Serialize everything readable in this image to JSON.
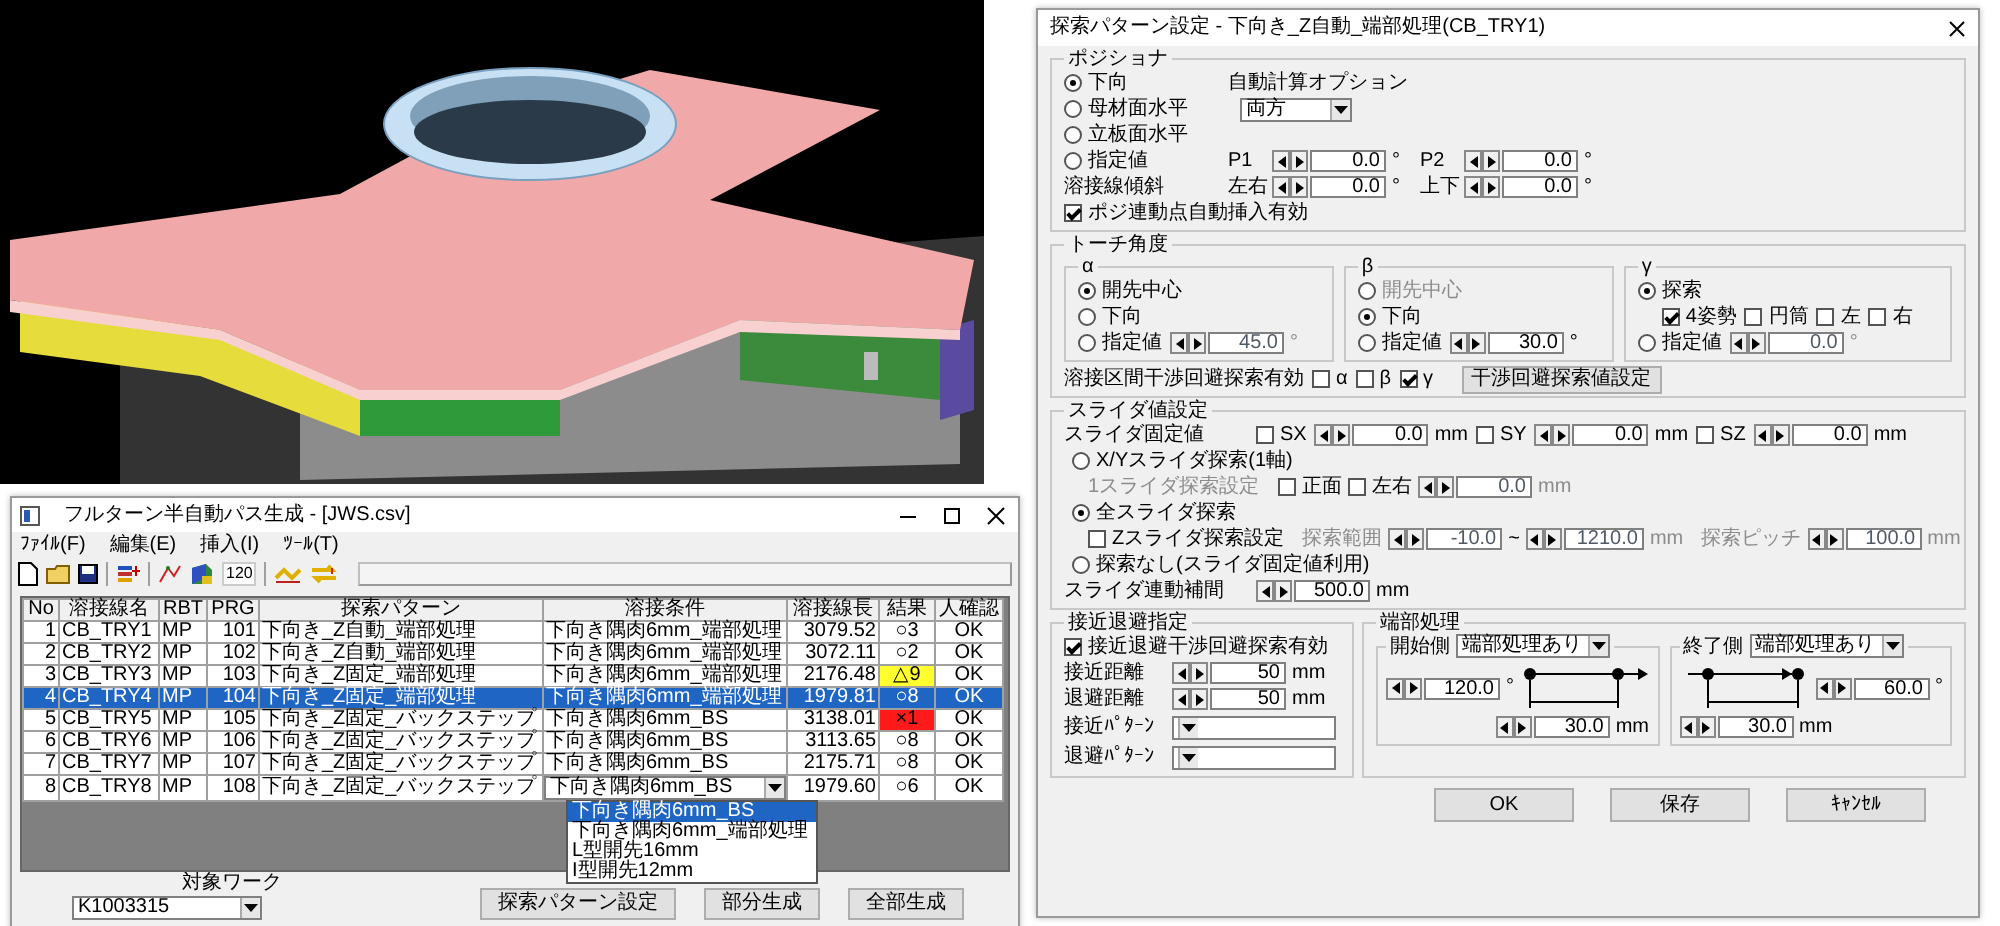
{
  "main_window": {
    "title": "フルターン半自動パス生成 - [JWS.csv]",
    "menu": [
      "ﾌｧｲﾙ(F)",
      "編集(E)",
      "挿入(I)",
      "ﾂｰﾙ(T)"
    ],
    "toolbar_text": "120",
    "table": {
      "columns": [
        "No",
        "溶接線名",
        "RBT",
        "PRG",
        "探索パターン",
        "溶接条件",
        "溶接線長",
        "結果",
        "人確認"
      ],
      "rows": [
        {
          "cells": [
            "1",
            "CB_TRY1",
            "MP",
            "101",
            "下向き_Z自動_端部処理",
            "下向き隅肉6mm_端部処理",
            "3079.52",
            "○3",
            "OK"
          ],
          "selected": false,
          "editing": false
        },
        {
          "cells": [
            "2",
            "CB_TRY2",
            "MP",
            "102",
            "下向き_Z自動_端部処理",
            "下向き隅肉6mm_端部処理",
            "3072.11",
            "○2",
            "OK"
          ],
          "selected": false,
          "editing": false
        },
        {
          "cells": [
            "3",
            "CB_TRY3",
            "MP",
            "103",
            "下向き_Z固定_端部処理",
            "下向き隅肉6mm_端部処理",
            "2176.48",
            "△9",
            "OK"
          ],
          "selected": false,
          "color": "#ffff30",
          "editing": false
        },
        {
          "cells": [
            "4",
            "CB_TRY4",
            "MP",
            "104",
            "下向き_Z固定_端部処理",
            "下向き隅肉6mm_端部処理",
            "1979.81",
            "○8",
            "OK"
          ],
          "selected": true,
          "editing": false
        },
        {
          "cells": [
            "5",
            "CB_TRY5",
            "MP",
            "105",
            "下向き_Z固定_バックステップ",
            "下向き隅肉6mm_BS",
            "3138.01",
            "×1",
            "OK"
          ],
          "selected": false,
          "color": "#ff1a1a",
          "editing": false
        },
        {
          "cells": [
            "6",
            "CB_TRY6",
            "MP",
            "106",
            "下向き_Z固定_バックステップ",
            "下向き隅肉6mm_BS",
            "3113.65",
            "○8",
            "OK"
          ],
          "selected": false,
          "editing": false
        },
        {
          "cells": [
            "7",
            "CB_TRY7",
            "MP",
            "107",
            "下向き_Z固定_バックステップ",
            "下向き隅肉6mm_BS",
            "2175.71",
            "○8",
            "OK"
          ],
          "selected": false,
          "editing": false
        },
        {
          "cells": [
            "8",
            "CB_TRY8",
            "MP",
            "108",
            "下向き_Z固定_バックステップ",
            "下向き隅肉6mm_BS",
            "1979.60",
            "○6",
            "OK"
          ],
          "selected": false,
          "editing": true
        }
      ]
    },
    "dropdown_options": [
      {
        "label": "下向き隅肉6mm_BS",
        "selected": true
      },
      {
        "label": "下向き隅肉6mm_端部処理",
        "selected": false
      },
      {
        "label": "L型開先16mm",
        "selected": false
      },
      {
        "label": "I型開先12mm",
        "selected": false
      }
    ],
    "target": {
      "label": "対象ワーク",
      "value": "K1003315"
    },
    "buttons": [
      "探索パターン設定",
      "部分生成",
      "全部生成"
    ]
  },
  "dialog": {
    "title": "探索パターン設定 - 下向き_Z自動_端部処理(CB_TRY1)",
    "positioner": {
      "label": "ポジショナ",
      "radios": [
        {
          "label": "下向",
          "selected": true
        },
        {
          "label": "母材面水平",
          "selected": false
        },
        {
          "label": "立板面水平",
          "selected": false
        },
        {
          "label": "指定値",
          "selected": false
        }
      ],
      "auto_calc": {
        "label": "自動計算オプション",
        "value": "両方"
      },
      "p1": {
        "label": "P1",
        "value": "0.0",
        "unit": "°"
      },
      "p2": {
        "label": "P2",
        "value": "0.0",
        "unit": "°"
      },
      "tilt": {
        "label": "溶接線傾斜",
        "lr": {
          "label": "左右",
          "value": "0.0",
          "unit": "°"
        },
        "ud": {
          "label": "上下",
          "value": "0.0",
          "unit": "°"
        }
      },
      "auto_insert": {
        "label": "ポジ連動点自動挿入有効",
        "checked": true
      }
    },
    "torch": {
      "label": "トーチ角度",
      "groups": [
        {
          "kind": "angle",
          "label": "α",
          "radios": [
            {
              "label": "開先中心",
              "selected": true,
              "disabled": false
            },
            {
              "label": "下向",
              "selected": false,
              "disabled": false
            },
            {
              "label": "指定値",
              "selected": false,
              "disabled": false
            }
          ],
          "spin": {
            "value": "45.0",
            "unit": "°",
            "disabled": true
          }
        },
        {
          "kind": "angle",
          "label": "β",
          "radios": [
            {
              "label": "開先中心",
              "selected": false,
              "disabled": true
            },
            {
              "label": "下向",
              "selected": true,
              "disabled": false
            },
            {
              "label": "指定値",
              "selected": false,
              "disabled": false
            }
          ],
          "spin": {
            "value": "30.0",
            "unit": "°",
            "disabled": false
          }
        },
        {
          "kind": "search",
          "label": "γ",
          "radios": [
            {
              "label": "探索",
              "selected": true
            },
            {
              "label": "指定値",
              "selected": false
            }
          ],
          "checks": [
            {
              "label": "4姿勢",
              "checked": true
            },
            {
              "label": "円筒",
              "checked": false
            },
            {
              "label": "左",
              "checked": false
            },
            {
              "label": "右",
              "checked": false
            }
          ],
          "spin": {
            "value": "0.0",
            "unit": "°",
            "disabled": true
          }
        }
      ],
      "avoid": {
        "label": "溶接区間干渉回避探索有効",
        "checks": [
          {
            "label": "α",
            "checked": false
          },
          {
            "label": "β",
            "checked": false
          },
          {
            "label": "γ",
            "checked": true
          }
        ],
        "button": "干渉回避探索値設定"
      }
    },
    "slider": {
      "label": "スライダ値設定",
      "fixed": {
        "label": "スライダ固定値",
        "items": [
          {
            "label": "SX",
            "checked": false,
            "value": "0.0",
            "unit": "mm"
          },
          {
            "label": "SY",
            "checked": false,
            "value": "0.0",
            "unit": "mm"
          },
          {
            "label": "SZ",
            "checked": false,
            "value": "0.0",
            "unit": "mm"
          }
        ]
      },
      "modes": [
        {
          "kind": "single",
          "label": "X/Yスライダ探索(1軸)",
          "selected": false,
          "setting": "1スライダ探索設定",
          "checks": [
            {
              "label": "正面",
              "checked": false
            },
            {
              "label": "左右",
              "checked": false
            }
          ],
          "spin": {
            "value": "0.0",
            "unit": "mm",
            "disabled": true
          }
        },
        {
          "kind": "all",
          "label": "全スライダ探索",
          "selected": true,
          "z_check": {
            "label": "Zスライダ探索設定",
            "checked": false
          },
          "range": {
            "label": "探索範囲",
            "from": {
              "value": "-10.0",
              "disabled": true
            },
            "sep": "~",
            "to": {
              "value": "1210.0",
              "unit": "mm",
              "disabled": true
            }
          },
          "pitch": {
            "label": "探索ピッチ",
            "value": "100.0",
            "unit": "mm",
            "disabled": true
          }
        },
        {
          "kind": "none",
          "label": "探索なし(スライダ固定値利用)",
          "selected": false
        }
      ],
      "interp": {
        "label": "スライダ連動補間",
        "value": "500.0",
        "unit": "mm"
      }
    },
    "approach": {
      "label": "接近退避指定",
      "check": {
        "label": "接近退避干渉回避探索有効",
        "checked": true
      },
      "distances": [
        {
          "label": "接近距離",
          "value": "50",
          "unit": "mm"
        },
        {
          "label": "退避距離",
          "value": "50",
          "unit": "mm"
        }
      ],
      "patterns": [
        {
          "label": "接近ﾊﾟﾀｰﾝ"
        },
        {
          "label": "退避ﾊﾟﾀｰﾝ"
        }
      ]
    },
    "ends": {
      "label": "端部処理",
      "sides": [
        {
          "kind": "start",
          "label": "開始側",
          "mode": "端部処理あり",
          "angle": {
            "value": "120.0",
            "unit": "°"
          },
          "length": {
            "value": "30.0",
            "unit": "mm"
          }
        },
        {
          "kind": "end",
          "label": "終了側",
          "mode": "端部処理あり",
          "angle": {
            "value": "60.0",
            "unit": "°"
          },
          "length": {
            "value": "30.0",
            "unit": "mm"
          }
        }
      ]
    },
    "buttons": [
      "OK",
      "保存",
      "ｷｬﾝｾﾙ"
    ]
  }
}
